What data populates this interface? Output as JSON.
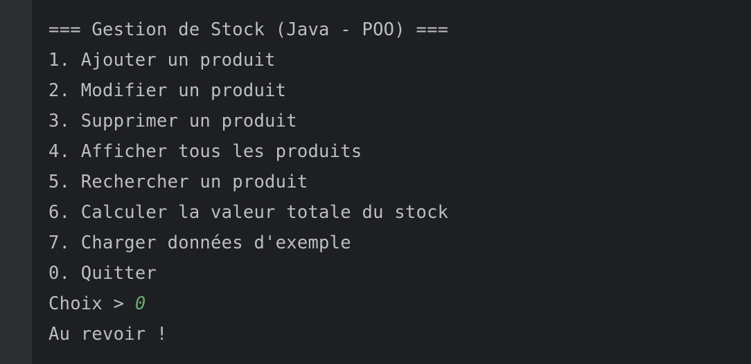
{
  "console": {
    "lines": [
      "=== Gestion de Stock (Java - POO) ===",
      "1. Ajouter un produit",
      "2. Modifier un produit",
      "3. Supprimer un produit",
      "4. Afficher tous les produits",
      "5. Rechercher un produit",
      "6. Calculer la valeur totale du stock",
      "7. Charger données d'exemple",
      "0. Quitter"
    ],
    "prompt": "Choix > ",
    "user_input": "0",
    "farewell": "Au revoir !"
  },
  "colors": {
    "background": "#1e1f22",
    "gutter": "#2b2d30",
    "text": "#bcbec4",
    "input": "#6aab73"
  }
}
